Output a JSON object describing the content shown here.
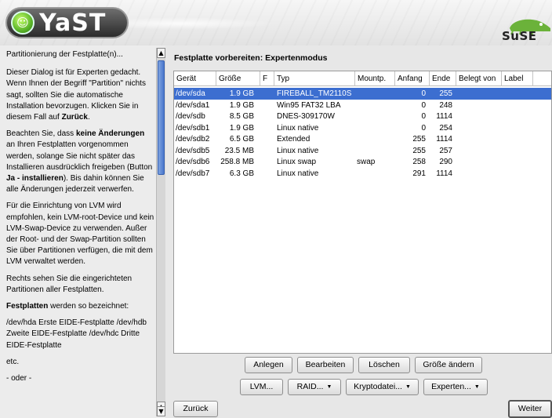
{
  "header": {
    "app_logo": "YaST",
    "brand_logo": "SuSE"
  },
  "help": {
    "paragraphs": [
      "Partitionierung der Festplatte(n)...",
      "Dieser Dialog ist für Experten gedacht. Wenn Ihnen der Begriff \"Partition\" nichts sagt, sollten Sie die automatische Installation bevorzugen. Klicken Sie in diesem Fall auf Zurück.",
      "Beachten Sie, dass keine Änderungen an Ihren Festplatten vorgenommen werden, solange Sie nicht später das Installieren ausdrücklich freigeben (Button Ja - installieren). Bis dahin können Sie alle Änderungen jederzeit verwerfen.",
      "Für die Einrichtung von LVM wird empfohlen, kein LVM-root-Device und kein LVM-Swap-Device zu verwenden. Außer der Root- und der Swap-Partition sollten Sie über Partitionen verfügen, die mit dem LVM verwaltet werden.",
      "Rechts sehen Sie die eingerichteten Partitionen aller Festplatten.",
      "Festplatten werden so bezeichnet:",
      "/dev/hda Erste EIDE-Festplatte /dev/hdb Zweite EIDE-Festplatte /dev/hdc Dritte EIDE-Festplatte",
      "etc.",
      "- oder -"
    ],
    "bold_terms": [
      "Zurück",
      "keine Änderungen",
      "Ja - installieren",
      "Festplatten"
    ]
  },
  "main": {
    "title": "Festplatte vorbereiten: Expertenmodus",
    "table": {
      "columns": [
        "Gerät",
        "Größe",
        "F",
        "Typ",
        "Mountp.",
        "Anfang",
        "Ende",
        "Belegt von",
        "Label"
      ],
      "rows": [
        {
          "device": "/dev/sda",
          "size": "1.9 GB",
          "f": "",
          "type": "FIREBALL_TM2110S",
          "mount": "",
          "start": "0",
          "end": "255",
          "used_by": "",
          "label": "",
          "selected": true
        },
        {
          "device": "/dev/sda1",
          "size": "1.9 GB",
          "f": "",
          "type": "Win95 FAT32 LBA",
          "mount": "",
          "start": "0",
          "end": "248",
          "used_by": "",
          "label": ""
        },
        {
          "device": "/dev/sdb",
          "size": "8.5 GB",
          "f": "",
          "type": "DNES-309170W",
          "mount": "",
          "start": "0",
          "end": "1114",
          "used_by": "",
          "label": ""
        },
        {
          "device": "/dev/sdb1",
          "size": "1.9 GB",
          "f": "",
          "type": "Linux native",
          "mount": "",
          "start": "0",
          "end": "254",
          "used_by": "",
          "label": ""
        },
        {
          "device": "/dev/sdb2",
          "size": "6.5 GB",
          "f": "",
          "type": "Extended",
          "mount": "",
          "start": "255",
          "end": "1114",
          "used_by": "",
          "label": ""
        },
        {
          "device": "/dev/sdb5",
          "size": "23.5 MB",
          "f": "",
          "type": "Linux native",
          "mount": "",
          "start": "255",
          "end": "257",
          "used_by": "",
          "label": ""
        },
        {
          "device": "/dev/sdb6",
          "size": "258.8 MB",
          "f": "",
          "type": "Linux swap",
          "mount": "swap",
          "start": "258",
          "end": "290",
          "used_by": "",
          "label": ""
        },
        {
          "device": "/dev/sdb7",
          "size": "6.3 GB",
          "f": "",
          "type": "Linux native",
          "mount": "",
          "start": "291",
          "end": "1114",
          "used_by": "",
          "label": ""
        }
      ]
    },
    "buttons": {
      "create": "Anlegen",
      "edit": "Bearbeiten",
      "delete": "Löschen",
      "resize": "Größe ändern",
      "lvm": "LVM...",
      "raid": "RAID...",
      "crypto": "Kryptodatei...",
      "expert": "Experten..."
    }
  },
  "nav": {
    "back": "Zurück",
    "next": "Weiter"
  },
  "colors": {
    "selection": "#3c6ed0",
    "scroll_thumb": "#4a77cc"
  }
}
